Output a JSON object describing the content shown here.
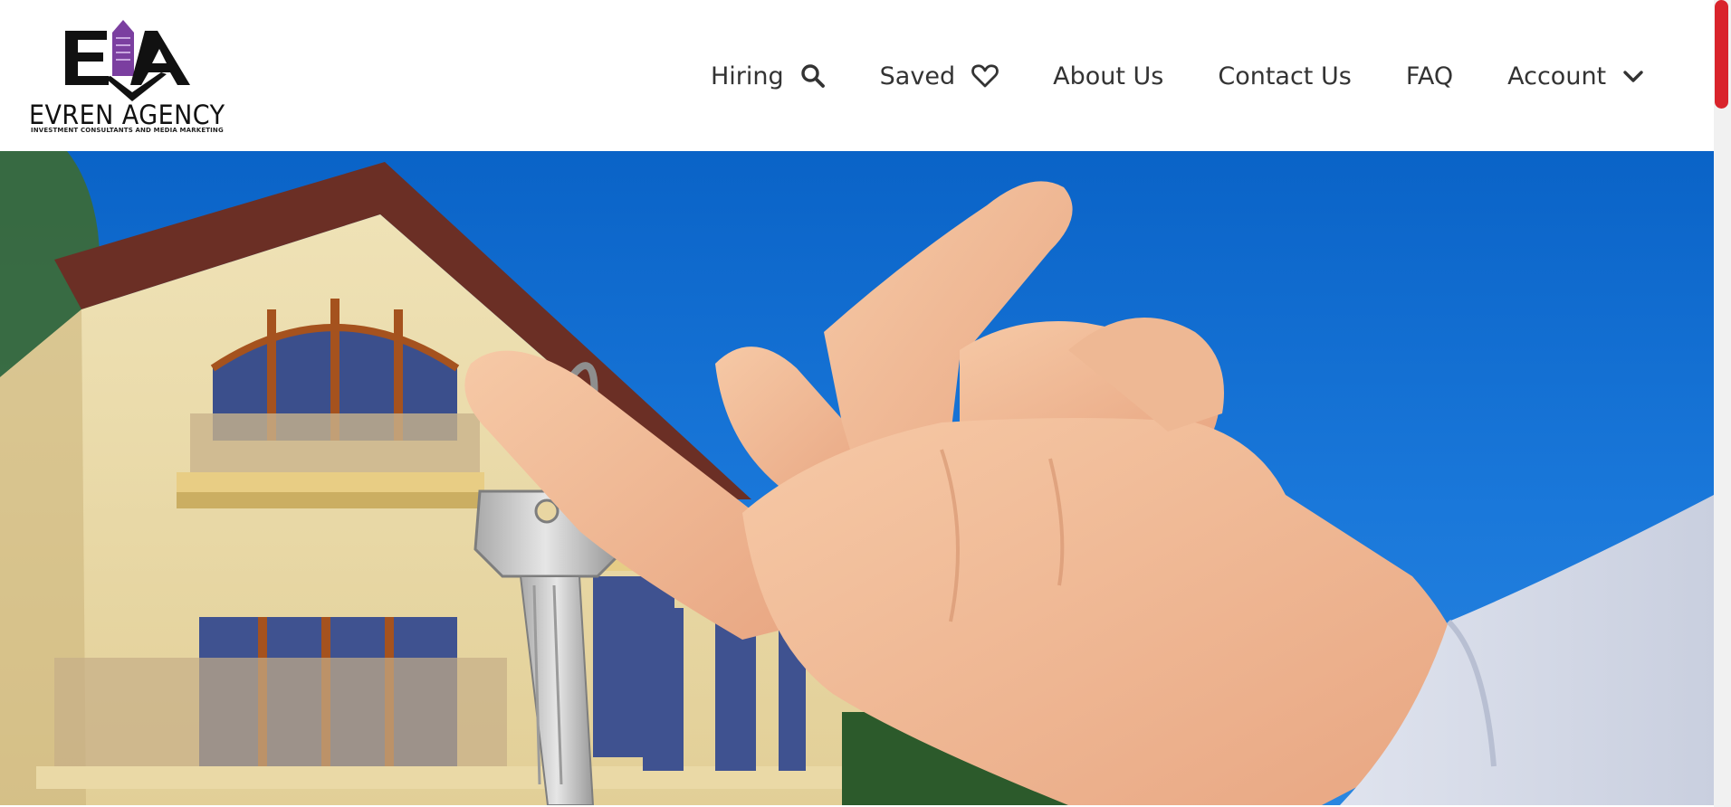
{
  "header": {
    "logo": {
      "monogram": "EA",
      "name": "EVREN AGENCY",
      "tagline": "INVESTMENT CONSULTANTS AND MEDIA MARKETING",
      "accent_color": "#7b3fa0"
    },
    "nav": [
      {
        "label": "Hiring",
        "icon": "search-icon"
      },
      {
        "label": "Saved",
        "icon": "heart-icon"
      },
      {
        "label": "About Us"
      },
      {
        "label": "Contact Us"
      },
      {
        "label": "FAQ"
      },
      {
        "label": "Account",
        "icon": "chevron-down-icon"
      }
    ]
  },
  "hero": {
    "image": "hand-holding-house-keys-photo"
  },
  "colors": {
    "scrollbar_thumb": "#d9242c",
    "sky": "#1a78da"
  }
}
